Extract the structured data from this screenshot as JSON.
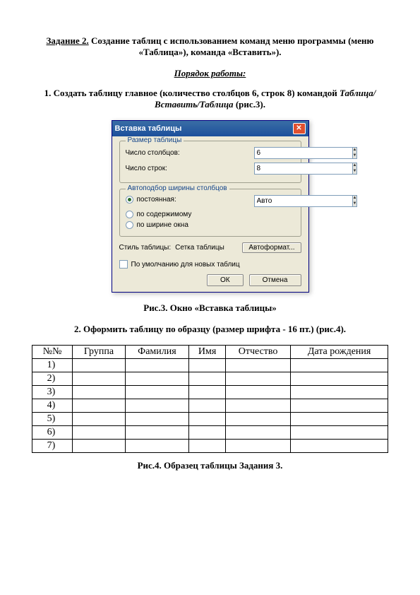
{
  "task": {
    "label": "Задание 2.",
    "title_line1": "Создание таблиц с использованием команд меню программы (меню",
    "title_line2": "«Таблица»), команда «Вставить»)."
  },
  "workorder_heading": "Порядок работы:",
  "step1": {
    "line1": "1. Создать таблицу главное (количество столбцов 6, строк 8) командой ",
    "italic": "Таблица/ Вставить/Таблица",
    "tail": " (рис.3)."
  },
  "dialog": {
    "title": "Вставка таблицы",
    "group_size": "Размер таблицы",
    "cols_label": "Число столбцов:",
    "cols_value": "6",
    "rows_label": "Число строк:",
    "rows_value": "8",
    "group_autofit": "Автоподбор ширины столбцов",
    "radio_fixed": "постоянная:",
    "fixed_value": "Авто",
    "radio_content": "по содержимому",
    "radio_window": "по ширине окна",
    "style_label": "Стиль таблицы:",
    "style_value": "Сетка таблицы",
    "autoformat_btn": "Автоформат...",
    "default_check": "По умолчанию для новых таблиц",
    "ok": "ОК",
    "cancel": "Отмена"
  },
  "fig3_caption": "Рис.3. Окно «Вставка таблицы»",
  "step2": "2. Оформить таблицу по образцу (размер шрифта - 16 пт.) (рис.4).",
  "table": {
    "headers": [
      "№№",
      "Группа",
      "Фамилия",
      "Имя",
      "Отчество",
      "Дата рождения"
    ],
    "rows": [
      "1)",
      "2)",
      "3)",
      "4)",
      "5)",
      "6)",
      "7)"
    ]
  },
  "fig4_caption": "Рис.4. Образец таблицы Задания 3."
}
